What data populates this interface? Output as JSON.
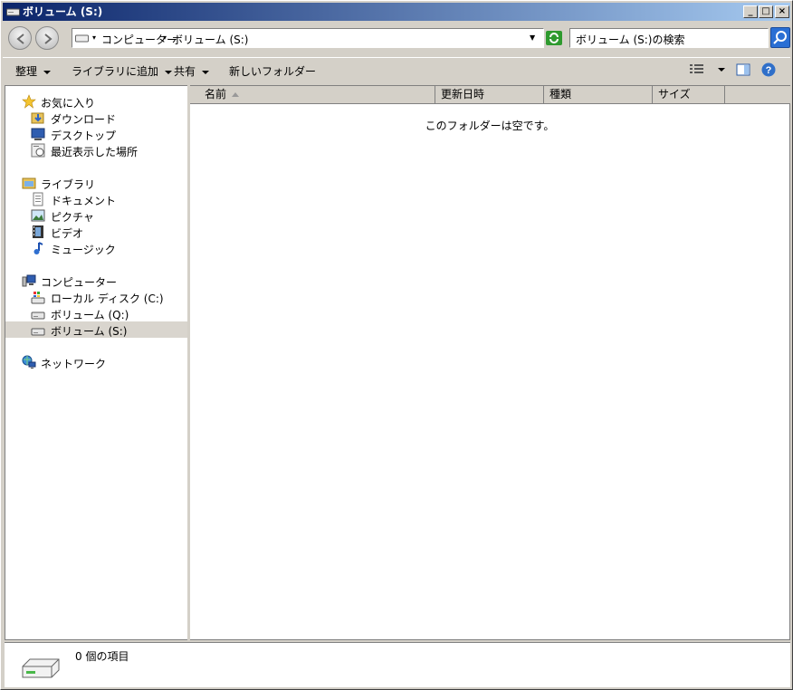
{
  "window": {
    "title": "ボリューム (S:)",
    "min_glyph": "_",
    "max_glyph": "□",
    "close_glyph": "×"
  },
  "address": {
    "segments": [
      "コンピューター",
      "ボリューム (S:)"
    ],
    "search_placeholder": "ボリューム (S:)の検索"
  },
  "toolbar": {
    "organize": "整理",
    "add_to_library": "ライブラリに追加",
    "share": "共有",
    "new_folder": "新しいフォルダー"
  },
  "sidebar": {
    "favorites": {
      "label": "お気に入り",
      "items": [
        "ダウンロード",
        "デスクトップ",
        "最近表示した場所"
      ]
    },
    "libraries": {
      "label": "ライブラリ",
      "items": [
        "ドキュメント",
        "ピクチャ",
        "ビデオ",
        "ミュージック"
      ]
    },
    "computer": {
      "label": "コンピューター",
      "items": [
        "ローカル ディスク (C:)",
        "ボリューム (Q:)",
        "ボリューム (S:)"
      ]
    },
    "network": {
      "label": "ネットワーク"
    }
  },
  "columns": [
    "名前",
    "更新日時",
    "種類",
    "サイズ"
  ],
  "empty_message": "このフォルダーは空です。",
  "status": {
    "count_text": "0 個の項目"
  },
  "colors": {
    "title_start": "#0a246a",
    "title_end": "#a6caf0",
    "selected_bg": "#d9d5ce"
  }
}
